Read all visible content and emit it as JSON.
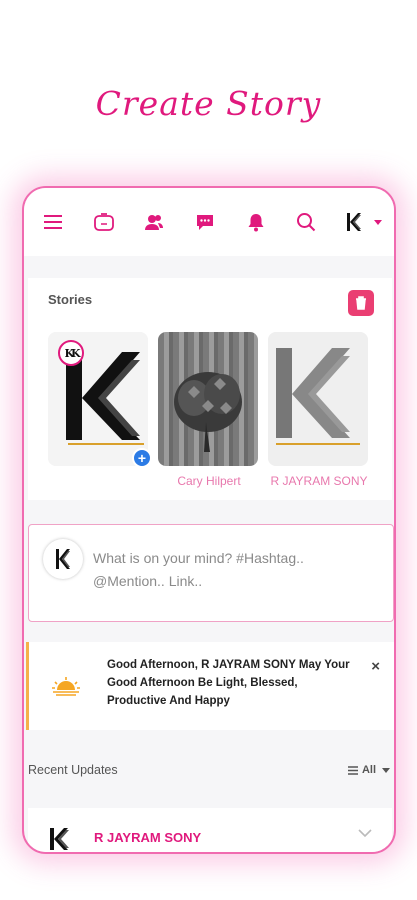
{
  "headline": "Create Story",
  "nav": {
    "icons": [
      "menu-icon",
      "feed-icon",
      "friends-icon",
      "messages-icon",
      "notifications-icon",
      "search-icon"
    ],
    "accent": "#e0197d"
  },
  "stories": {
    "title": "Stories",
    "items": [
      {
        "name": ""
      },
      {
        "name": "Cary Hilpert"
      },
      {
        "name": "R JAYRAM SONY"
      }
    ]
  },
  "composer": {
    "placeholder": "What is on your mind? #Hashtag.. @Mention.. Link.."
  },
  "greeting": {
    "text": "Good Afternoon, R JAYRAM SONY May Your Good Afternoon Be Light, Blessed, Productive And Happy",
    "close": "×"
  },
  "recent": {
    "title": "Recent Updates",
    "filter": "All"
  },
  "post": {
    "author": "R JAYRAM SONY"
  }
}
